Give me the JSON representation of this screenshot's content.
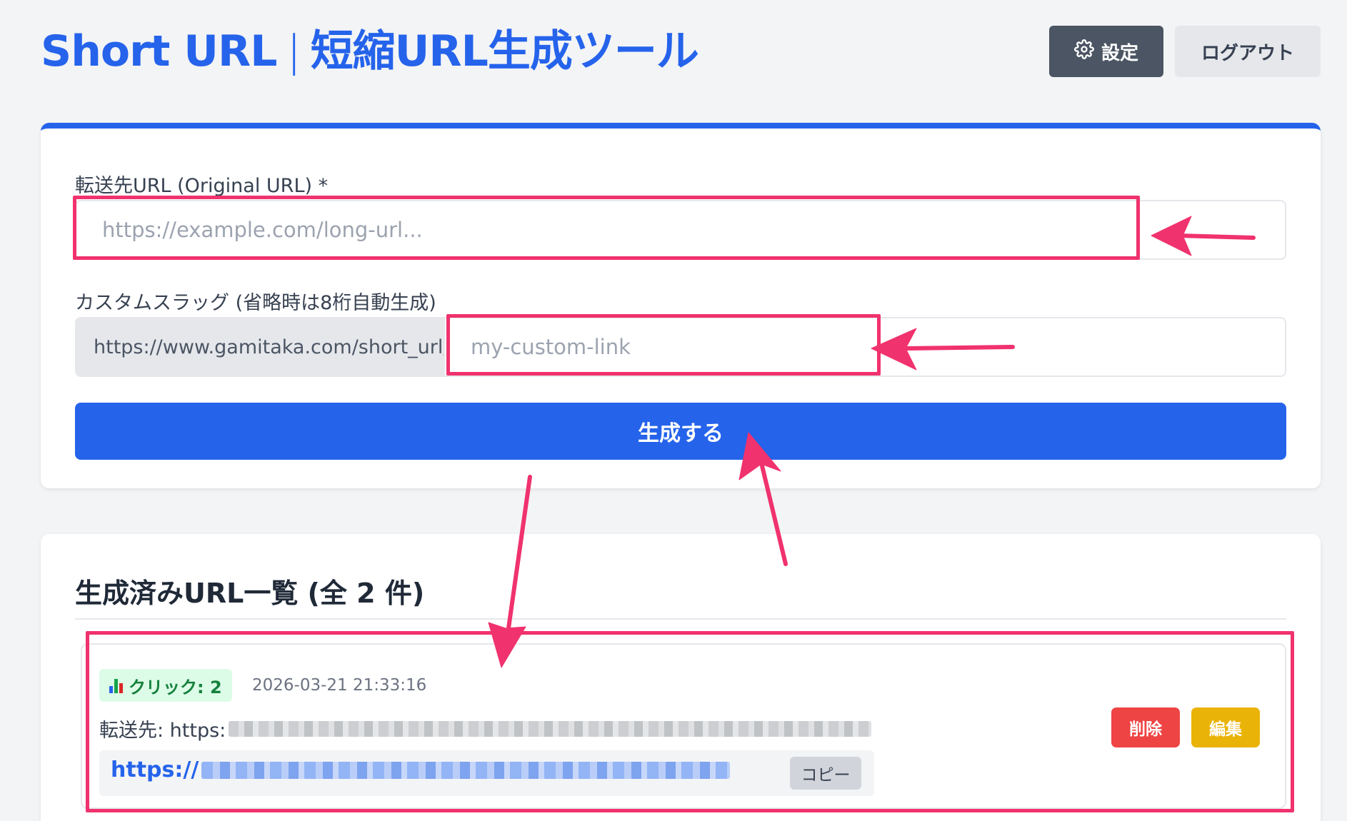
{
  "header": {
    "title_main": "Short URL",
    "title_separator": "|",
    "title_sub": "短縮URL生成ツール",
    "settings_label": "設定",
    "logout_label": "ログアウト"
  },
  "form": {
    "url_label": "転送先URL (Original URL) *",
    "url_placeholder": "https://example.com/long-url...",
    "slug_label": "カスタムスラッグ (省略時は8桁自動生成)",
    "slug_prefix": "https://www.gamitaka.com/short_url/",
    "slug_placeholder": "my-custom-link",
    "generate_label": "生成する"
  },
  "list": {
    "heading": "生成済みURL一覧 (全 2 件)",
    "items": [
      {
        "clicks_label": "クリック: 2",
        "created_at": "2026-03-21 21:33:16",
        "dest_prefix": "転送先: https:",
        "short_prefix": "https://",
        "copy_label": "コピー",
        "delete_label": "削除",
        "edit_label": "編集"
      }
    ]
  },
  "colors": {
    "accent": "#2563eb",
    "annotation": "#f0326e",
    "delete": "#ef4444",
    "edit": "#eab308",
    "badge_bg": "#dcfce7",
    "badge_text": "#15803d"
  },
  "icons": {
    "settings": "gear-icon",
    "clicks": "bar-chart-icon"
  }
}
